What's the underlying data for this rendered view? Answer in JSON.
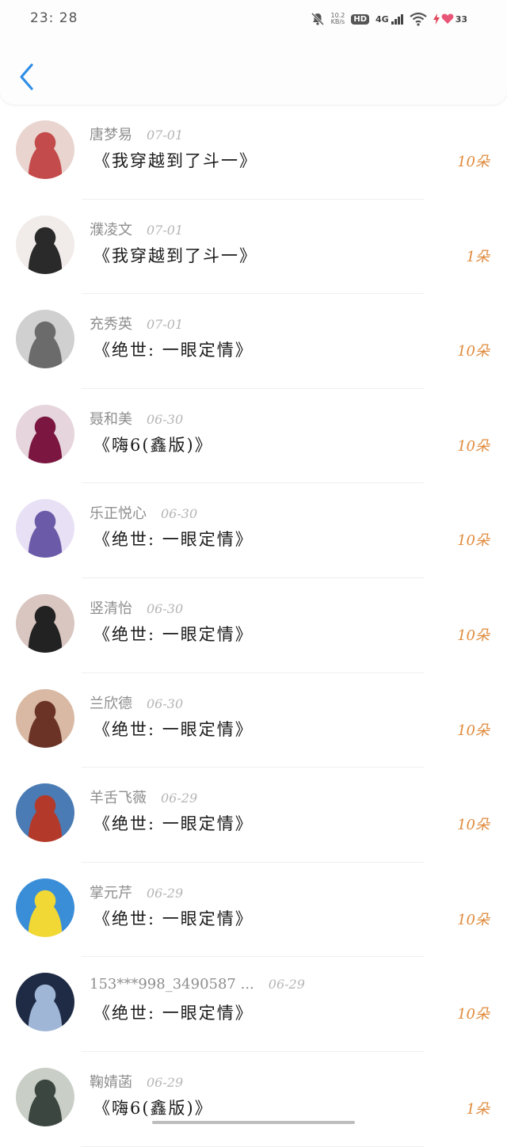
{
  "status_bar": {
    "time": "23: 28",
    "speed_value": "10.2",
    "speed_unit": "KB/s",
    "hd_label": "HD",
    "network_label": "4G",
    "battery_level": "33"
  },
  "entries": [
    {
      "name": "唐梦易",
      "date": "07-01",
      "book": "《我穿越到了斗一》",
      "amount": "10朵",
      "avatar_colors": [
        "#e9d4cf",
        "#c44b4b"
      ]
    },
    {
      "name": "濮凌文",
      "date": "07-01",
      "book": "《我穿越到了斗一》",
      "amount": "1朵",
      "avatar_colors": [
        "#f1ece9",
        "#2a2a2a"
      ]
    },
    {
      "name": "充秀英",
      "date": "07-01",
      "book": "《绝世: 一眼定情》",
      "amount": "10朵",
      "avatar_colors": [
        "#d0d0d0",
        "#6b6b6b"
      ]
    },
    {
      "name": "聂和美",
      "date": "06-30",
      "book": "《嗨6(鑫版)》",
      "amount": "10朵",
      "avatar_colors": [
        "#e6d5dc",
        "#7a1640"
      ]
    },
    {
      "name": "乐正悦心",
      "date": "06-30",
      "book": "《绝世: 一眼定情》",
      "amount": "10朵",
      "avatar_colors": [
        "#e8e0f4",
        "#6b5aa8"
      ]
    },
    {
      "name": "竖清怡",
      "date": "06-30",
      "book": "《绝世: 一眼定情》",
      "amount": "10朵",
      "avatar_colors": [
        "#d9c6c0",
        "#222222"
      ]
    },
    {
      "name": "兰欣德",
      "date": "06-30",
      "book": "《绝世: 一眼定情》",
      "amount": "10朵",
      "avatar_colors": [
        "#d9b9a3",
        "#6a3326"
      ]
    },
    {
      "name": "羊舌飞薇",
      "date": "06-29",
      "book": "《绝世: 一眼定情》",
      "amount": "10朵",
      "avatar_colors": [
        "#4a7bb4",
        "#b33a2a"
      ]
    },
    {
      "name": "掌元芹",
      "date": "06-29",
      "book": "《绝世: 一眼定情》",
      "amount": "10朵",
      "avatar_colors": [
        "#3a8ed8",
        "#f2d835"
      ]
    },
    {
      "name": "153***998_3490587 ...",
      "date": "06-29",
      "book": "《绝世: 一眼定情》",
      "amount": "10朵",
      "avatar_colors": [
        "#1f2b45",
        "#9fb6d6"
      ]
    },
    {
      "name": "鞠婧菡",
      "date": "06-29",
      "book": "《嗨6(鑫版)》",
      "amount": "1朵",
      "avatar_colors": [
        "#c9cfc7",
        "#3b4640"
      ]
    }
  ],
  "colors": {
    "accent": "#2f8ee6",
    "amount": "#e08a3c",
    "name": "#8e8e8e",
    "date": "#b5b5b5"
  }
}
